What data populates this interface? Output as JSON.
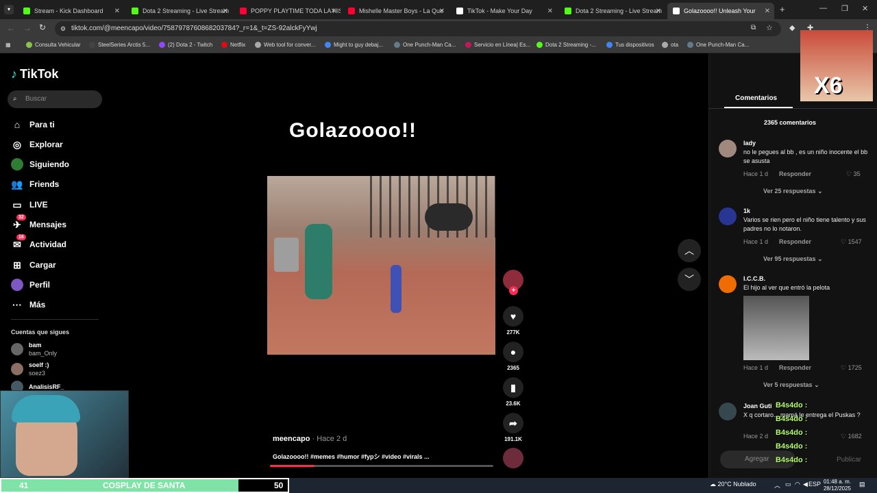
{
  "browser": {
    "tabs": [
      {
        "title": "Stream - Kick Dashboard",
        "color": "#53fc18"
      },
      {
        "title": "Dota 2 Streaming - Live Stream",
        "color": "#53fc18"
      },
      {
        "title": "POPPY PLAYTIME TODA LA HIS",
        "color": "#ff0033"
      },
      {
        "title": "Mishelle Master Boys - La Que",
        "color": "#ff0033"
      },
      {
        "title": "TikTok - Make Your Day",
        "color": "#ffffff"
      },
      {
        "title": "Dota 2 Streaming - Live Stream",
        "color": "#53fc18"
      },
      {
        "title": "Golazoooo!! Unleash Your",
        "color": "#ffffff"
      }
    ],
    "url": "tiktok.com/@meencapo/video/7587978760868203784?_r=1&_t=ZS-92alckFyYwj",
    "bookmarks": [
      "Consulta Vehicular",
      "SteelSeries Arctis 5...",
      "(2) Dota 2 - Twitch",
      "Netflix",
      "Web tool for conver...",
      "Might to guy debaj...",
      "One Punch-Man Ca...",
      "Servicio en Línea| Es...",
      "Dota 2 Streaming -...",
      "Tus dispositivos",
      "ota",
      "One Punch-Man Ca..."
    ]
  },
  "sidebar": {
    "logo": "TikTok",
    "search_placeholder": "Buscar",
    "nav": [
      {
        "label": "Para ti"
      },
      {
        "label": "Explorar"
      },
      {
        "label": "Siguiendo"
      },
      {
        "label": "Friends"
      },
      {
        "label": "LIVE"
      },
      {
        "label": "Mensajes",
        "badge": "32"
      },
      {
        "label": "Actividad",
        "badge": "16"
      },
      {
        "label": "Cargar"
      },
      {
        "label": "Perfil"
      },
      {
        "label": "Más"
      }
    ],
    "following_title": "Cuentas que sigues",
    "following": [
      {
        "name": "bam",
        "handle": "bam_Only"
      },
      {
        "name": "soelf :)",
        "handle": "soez3"
      },
      {
        "name": "AnalisisRF_",
        "handle": ""
      }
    ]
  },
  "video": {
    "title": "Golazoooo!!",
    "author": "meencapo",
    "posted": "· Hace 2 d",
    "caption": "Golazoooo!! #memes #humor #fypシ #video #virals ...",
    "likes": "277K",
    "comments": "2365",
    "saves": "23.6K",
    "shares": "191.1K",
    "progress": 0.2
  },
  "comments": {
    "tab": "Comentarios",
    "count_label": "2365 comentarios",
    "items": [
      {
        "name": "lady",
        "text": "no le pegues al bb , es un niño inocente el bb se asusta",
        "time": "Hace 1 d",
        "reply": "Responder",
        "likes": "35",
        "more": "Ver 25 respuestas"
      },
      {
        "name": "1k",
        "text": "Varios se rien pero el niño tiene talento y sus padres no lo notaron.",
        "time": "Hace 1 d",
        "reply": "Responder",
        "likes": "1547",
        "more": "Ver 95 respuestas"
      },
      {
        "name": "I.C.C.B.",
        "text": "El hijo al ver que entró la pelota",
        "time": "Hace 1 d",
        "reply": "Responder",
        "likes": "1725",
        "more": "Ver 5 respuestas"
      },
      {
        "name": "Joan Guti",
        "text": "X q cortaro... mamá le entrega el Puskas ?",
        "time": "Hace 2 d",
        "reply": "Responder",
        "likes": "1682"
      }
    ],
    "input_placeholder": "Agregar",
    "publish": "Publicar"
  },
  "overlay": {
    "multiplier": "X6",
    "chat_lines": [
      "B4s4do :",
      "B4s4do :",
      "B4s4do :",
      "B4s4do :",
      "B4s4do :"
    ],
    "goal_left": "41",
    "goal_label": "COSPLAY DE SANTA",
    "goal_right": "50"
  },
  "taskbar": {
    "weather": "20°C Nublado",
    "lang": "ESP",
    "time": "01:48 a. m.",
    "date": "28/12/2025"
  }
}
